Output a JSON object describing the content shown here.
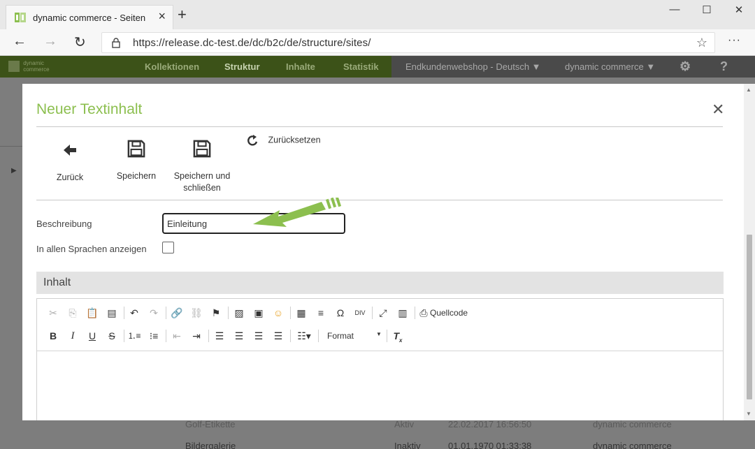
{
  "browser": {
    "tab_title": "dynamic commerce - Seiten",
    "url": "https://release.dc-test.de/dc/b2c/de/structure/sites/"
  },
  "appnav": {
    "logo_line1": "dynamic",
    "logo_line2": "commerce",
    "items": [
      "Kollektionen",
      "Struktur",
      "Inhalte",
      "Statistik"
    ],
    "active": "Struktur",
    "shop_select": "Endkundenwebshop - Deutsch",
    "company_select": "dynamic commerce"
  },
  "modal": {
    "title": "Neuer Textinhalt",
    "toolbar": {
      "back_label": "Zurück",
      "save_label": "Speichern",
      "save_close_line1": "Speichern und",
      "save_close_line2": "schließen",
      "reset_label": "Zurücksetzen"
    },
    "fields": {
      "description_label": "Beschreibung",
      "description_value": "Einleitung",
      "all_languages_label": "In allen Sprachen anzeigen"
    },
    "content_section_title": "Inhalt",
    "editor": {
      "source_label": "Quellcode",
      "format_label": "Format"
    }
  },
  "background_rows": [
    {
      "name": "Golf-Etikette",
      "status": "Aktiv",
      "date": "22.02.2017 16:56:50",
      "owner": "dynamic commerce"
    },
    {
      "name": "Bildergalerie",
      "status": "Inaktiv",
      "date": "01.01.1970 01:33:38",
      "owner": "dynamic commerce"
    }
  ],
  "colors": {
    "accent_green": "#8cbf4f",
    "nav_green": "#3c5218"
  }
}
